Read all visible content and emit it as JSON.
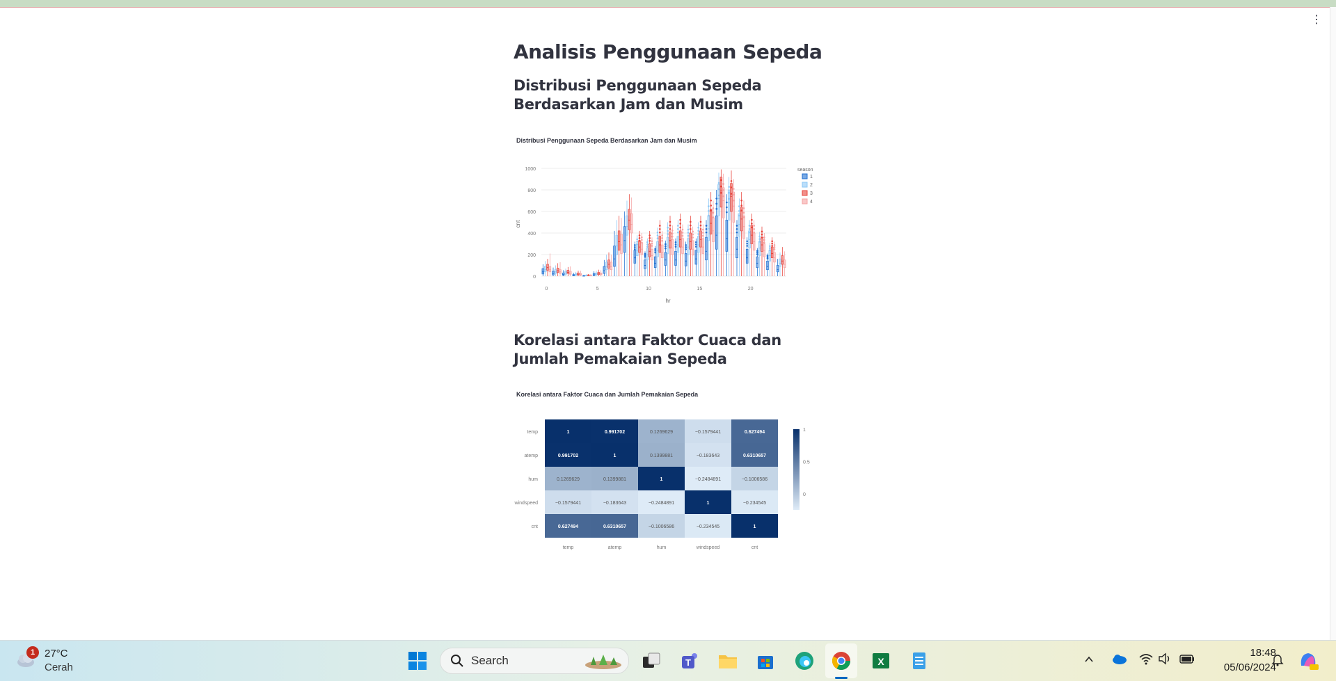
{
  "page": {
    "title": "Analisis Penggunaan Sepeda",
    "section1_heading": "Distribusi Penggunaan Sepeda Berdasarkan Jam dan Musim",
    "section2_heading": "Korelasi antara Faktor Cuaca dan Jumlah Pemakaian Sepeda",
    "menu_icon": "⋮"
  },
  "chart_data": [
    {
      "type": "box",
      "title": "Distribusi Penggunaan Sepeda Berdasarkan Jam dan Musim",
      "xlabel": "hr",
      "ylabel": "cnt",
      "x_ticks": [
        0,
        5,
        10,
        15,
        20
      ],
      "y_ticks": [
        0,
        200,
        400,
        600,
        800,
        1000
      ],
      "xlim": [
        -0.5,
        23.5
      ],
      "ylim": [
        0,
        1000
      ],
      "grid": true,
      "legend_title": "season",
      "legend_position": "top-right",
      "series": [
        {
          "name": "1",
          "color": "#1f6fd1",
          "median": [
            40,
            25,
            15,
            8,
            3,
            12,
            50,
            160,
            330,
            170,
            100,
            120,
            150,
            150,
            140,
            160,
            230,
            380,
            350,
            250,
            170,
            120,
            90,
            60
          ],
          "q1": [
            20,
            12,
            8,
            4,
            2,
            6,
            25,
            90,
            220,
            120,
            70,
            80,
            100,
            100,
            95,
            110,
            150,
            250,
            230,
            170,
            120,
            80,
            60,
            40
          ],
          "q3": [
            70,
            45,
            30,
            15,
            6,
            25,
            90,
            280,
            460,
            240,
            150,
            180,
            220,
            230,
            210,
            240,
            360,
            560,
            520,
            360,
            250,
            180,
            140,
            100
          ],
          "max": [
            110,
            80,
            55,
            30,
            12,
            45,
            150,
            420,
            600,
            320,
            230,
            280,
            330,
            350,
            320,
            350,
            520,
            800,
            760,
            520,
            360,
            260,
            210,
            160
          ]
        },
        {
          "name": "2",
          "color": "#8ec8f6",
          "median": [
            60,
            40,
            30,
            15,
            6,
            20,
            90,
            280,
            460,
            240,
            200,
            240,
            280,
            290,
            270,
            290,
            440,
            720,
            680,
            480,
            340,
            260,
            190,
            120
          ],
          "q1": [
            40,
            25,
            18,
            8,
            4,
            12,
            60,
            200,
            380,
            190,
            150,
            180,
            210,
            220,
            200,
            220,
            330,
            560,
            520,
            370,
            260,
            190,
            140,
            90
          ],
          "q3": [
            90,
            60,
            45,
            25,
            10,
            30,
            130,
            380,
            560,
            300,
            260,
            320,
            360,
            370,
            350,
            370,
            560,
            850,
            800,
            580,
            420,
            320,
            240,
            160
          ],
          "max": [
            140,
            100,
            70,
            40,
            18,
            50,
            200,
            520,
            700,
            380,
            350,
            450,
            500,
            520,
            480,
            500,
            720,
            960,
            920,
            720,
            520,
            410,
            310,
            220
          ]
        },
        {
          "name": "3",
          "color": "#e8453c",
          "median": [
            80,
            50,
            35,
            18,
            8,
            25,
            110,
            320,
            520,
            270,
            230,
            290,
            330,
            340,
            320,
            340,
            490,
            790,
            740,
            530,
            380,
            290,
            210,
            140
          ],
          "q1": [
            55,
            35,
            25,
            10,
            5,
            15,
            75,
            240,
            430,
            220,
            180,
            220,
            260,
            270,
            250,
            270,
            390,
            640,
            600,
            420,
            300,
            230,
            170,
            110
          ],
          "q3": [
            110,
            75,
            55,
            30,
            12,
            35,
            150,
            420,
            620,
            330,
            300,
            370,
            410,
            420,
            400,
            420,
            620,
            920,
            860,
            640,
            470,
            360,
            270,
            190
          ],
          "max": [
            160,
            120,
            85,
            50,
            20,
            60,
            220,
            560,
            760,
            420,
            420,
            520,
            560,
            580,
            560,
            560,
            780,
            990,
            980,
            780,
            580,
            460,
            360,
            270
          ]
        },
        {
          "name": "4",
          "color": "#f5a3a3",
          "median": [
            60,
            40,
            28,
            14,
            6,
            20,
            90,
            290,
            480,
            250,
            190,
            220,
            260,
            270,
            250,
            270,
            420,
            700,
            650,
            460,
            320,
            240,
            170,
            110
          ],
          "q1": [
            40,
            25,
            18,
            8,
            4,
            12,
            60,
            210,
            400,
            200,
            150,
            170,
            200,
            210,
            195,
            210,
            320,
            540,
            500,
            350,
            240,
            180,
            130,
            80
          ],
          "q3": [
            90,
            60,
            45,
            24,
            10,
            30,
            130,
            390,
            580,
            310,
            250,
            290,
            340,
            350,
            330,
            350,
            540,
            820,
            780,
            560,
            400,
            300,
            220,
            150
          ],
          "max": [
            210,
            130,
            90,
            50,
            20,
            55,
            200,
            540,
            730,
            400,
            360,
            420,
            470,
            480,
            460,
            480,
            700,
            950,
            900,
            700,
            520,
            400,
            320,
            230
          ]
        }
      ]
    },
    {
      "type": "heatmap",
      "title": "Korelasi antara Faktor Cuaca dan Jumlah Pemakaian Sepeda",
      "x_labels": [
        "temp",
        "atemp",
        "hum",
        "windspeed",
        "cnt"
      ],
      "y_labels": [
        "temp",
        "atemp",
        "hum",
        "windspeed",
        "cnt"
      ],
      "values": [
        [
          1,
          0.991702,
          0.1269629,
          -0.1579441,
          0.627494
        ],
        [
          0.991702,
          1,
          0.1399881,
          -0.183643,
          0.6310657
        ],
        [
          0.1269629,
          0.1399881,
          1,
          -0.2484891,
          -0.1006586
        ],
        [
          -0.1579441,
          -0.183643,
          -0.2484891,
          1,
          -0.234545
        ],
        [
          0.627494,
          0.6310657,
          -0.1006586,
          -0.234545,
          1
        ]
      ],
      "labels": [
        [
          "1",
          "0.991702",
          "0.1269629",
          "−0.1579441",
          "0.627494"
        ],
        [
          "0.991702",
          "1",
          "0.1399881",
          "−0.183643",
          "0.6310657"
        ],
        [
          "0.1269629",
          "0.1399881",
          "1",
          "−0.2484891",
          "−0.1006586"
        ],
        [
          "−0.1579441",
          "−0.183643",
          "−0.2484891",
          "1",
          "−0.234545"
        ],
        [
          "0.627494",
          "0.6310657",
          "−0.1006586",
          "−0.234545",
          "1"
        ]
      ],
      "colorbar_ticks": [
        "1",
        "0.5",
        "0"
      ],
      "colorbar_values": [
        1,
        0.5,
        0
      ],
      "zlim": [
        -0.25,
        1
      ],
      "colorscale": [
        "#deebf7",
        "#08306b"
      ],
      "legend_position": "right"
    }
  ],
  "taskbar": {
    "weather_temp": "27°C",
    "weather_desc": "Cerah",
    "weather_badge": "1",
    "search_placeholder": "Search",
    "clock_time": "18:48",
    "clock_date": "05/06/2024"
  }
}
